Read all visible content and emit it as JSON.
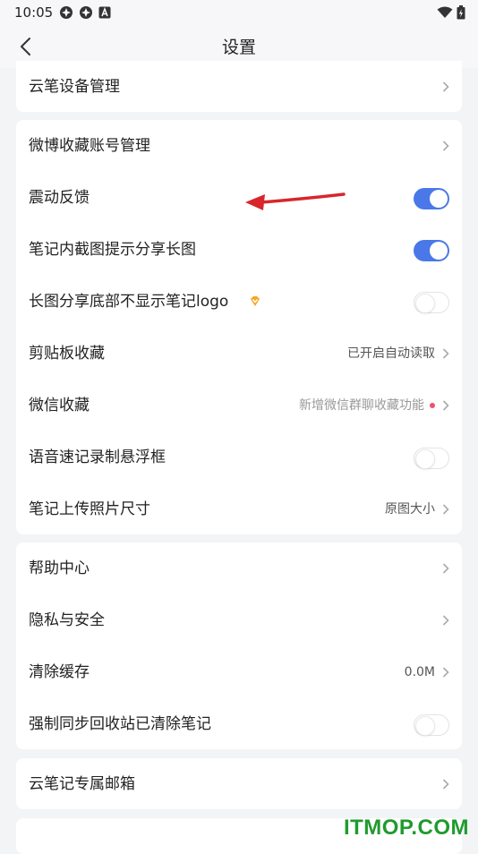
{
  "status": {
    "time": "10:05"
  },
  "header": {
    "title": "设置"
  },
  "section1": {
    "rows": [
      {
        "label": "云笔设备管理"
      }
    ]
  },
  "section2": {
    "rows": [
      {
        "label": "微博收藏账号管理"
      },
      {
        "label": "震动反馈",
        "toggle": true
      },
      {
        "label": "笔记内截图提示分享长图",
        "toggle": true
      },
      {
        "label": "长图分享底部不显示笔记logo",
        "toggle": false
      },
      {
        "label": "剪贴板收藏",
        "value": "已开启自动读取"
      },
      {
        "label": "微信收藏",
        "value": "新增微信群聊收藏功能"
      },
      {
        "label": "语音速记录制悬浮框",
        "toggle": false
      },
      {
        "label": "笔记上传照片尺寸",
        "value": "原图大小"
      }
    ]
  },
  "section3": {
    "rows": [
      {
        "label": "帮助中心"
      },
      {
        "label": "隐私与安全"
      },
      {
        "label": "清除缓存",
        "value": "0.0M"
      },
      {
        "label": "强制同步回收站已清除笔记",
        "toggle": false
      }
    ]
  },
  "section4": {
    "rows": [
      {
        "label": "云笔记专属邮箱"
      }
    ]
  },
  "watermark": "ITMOP.COM",
  "colors": {
    "accent": "#4a78e8",
    "badge_dot": "#f0506e",
    "arrow": "#d8262b",
    "watermark": "#1f9b2e"
  }
}
